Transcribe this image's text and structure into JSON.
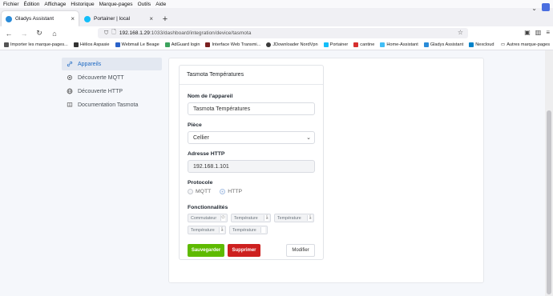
{
  "browser": {
    "menu": [
      "Fichier",
      "Édition",
      "Affichage",
      "Historique",
      "Marque-pages",
      "Outils",
      "Aide"
    ],
    "tabs": [
      {
        "title": "Gladys Assistant",
        "close": "×"
      },
      {
        "title": "Portainer | local",
        "close": "×"
      }
    ],
    "new_tab": "+",
    "url_host": "192.168.1.29",
    "url_rest": ":1033/dashboard/integration/device/tasmota",
    "bookmarks": [
      {
        "label": "Importer les marque-pages...",
        "color": "#555555"
      },
      {
        "label": "Hélios Aspasie",
        "color": "#333333"
      },
      {
        "label": "Webmail Le Beage",
        "color": "#2a62c9"
      },
      {
        "label": "AdGuard login",
        "color": "#3da35d"
      },
      {
        "label": "Interface Web Transmi...",
        "color": "#7a2020"
      },
      {
        "label": "JDownloader NordVpn",
        "color": "#3a3a3a"
      },
      {
        "label": "Portainer",
        "color": "#13bef9"
      },
      {
        "label": "cantine",
        "color": "#d62f2f"
      },
      {
        "label": "Home-Assistant",
        "color": "#41bdf5"
      },
      {
        "label": "Gladys Assistant",
        "color": "#2a8bd8"
      },
      {
        "label": "Nexcloud",
        "color": "#0082c9"
      }
    ],
    "other_bookmarks": "Autres marque-pages"
  },
  "sidebar": {
    "items": [
      {
        "label": "Appareils",
        "icon": "link-icon",
        "active": true
      },
      {
        "label": "Découverte MQTT",
        "icon": "settings-icon",
        "active": false
      },
      {
        "label": "Découverte HTTP",
        "icon": "globe-icon",
        "active": false
      },
      {
        "label": "Documentation Tasmota",
        "icon": "book-icon",
        "active": false
      }
    ]
  },
  "device": {
    "title": "Tasmota Températures",
    "name_label": "Nom de l'appareil",
    "name_value": "Tasmota Températures",
    "room_label": "Pièce",
    "room_value": "Cellier",
    "address_label": "Adresse HTTP",
    "address_value": "192.168.1.101",
    "protocol_label": "Protocole",
    "protocols": [
      {
        "label": "MQTT",
        "selected": false
      },
      {
        "label": "HTTP",
        "selected": true
      }
    ],
    "features_label": "Fonctionnalités",
    "features": [
      {
        "label": "Commutateur",
        "icon": "⏻"
      },
      {
        "label": "Température",
        "icon": "🌡"
      },
      {
        "label": "Température",
        "icon": "🌡"
      },
      {
        "label": "Température",
        "icon": "🌡"
      },
      {
        "label": "Température",
        "icon": ""
      }
    ],
    "buttons": {
      "save": "Sauvegarder",
      "delete": "Supprimer",
      "edit": "Modifier"
    }
  }
}
